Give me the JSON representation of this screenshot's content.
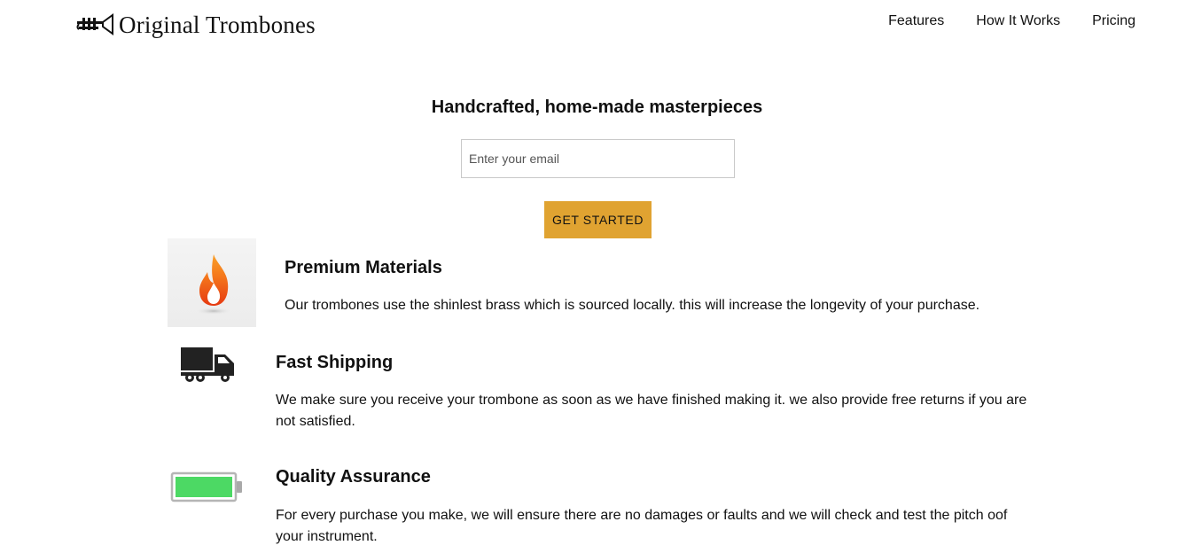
{
  "header": {
    "brand": "Original Trombones",
    "logo_icon": "trumpet-icon",
    "nav": [
      "Features",
      "How It Works",
      "Pricing"
    ]
  },
  "hero": {
    "title": "Handcrafted, home-made masterpieces",
    "email_placeholder": "Enter your email",
    "cta_label": "GET STARTED",
    "cta_color": "#e0a331"
  },
  "features": [
    {
      "icon": "flame-icon",
      "title": "Premium Materials",
      "text": "Our trombones use the shinlest brass which is sourced locally. this will increase the longevity of your purchase."
    },
    {
      "icon": "truck-icon",
      "title": "Fast Shipping",
      "text": "We make sure you receive your trombone as soon as we have finished making it. we also provide free returns if you are not satisfied."
    },
    {
      "icon": "battery-icon",
      "title": "Quality Assurance",
      "text": "For every purchase you make, we will ensure there are no damages or faults and we will check and test the pitch oof your instrument."
    }
  ]
}
